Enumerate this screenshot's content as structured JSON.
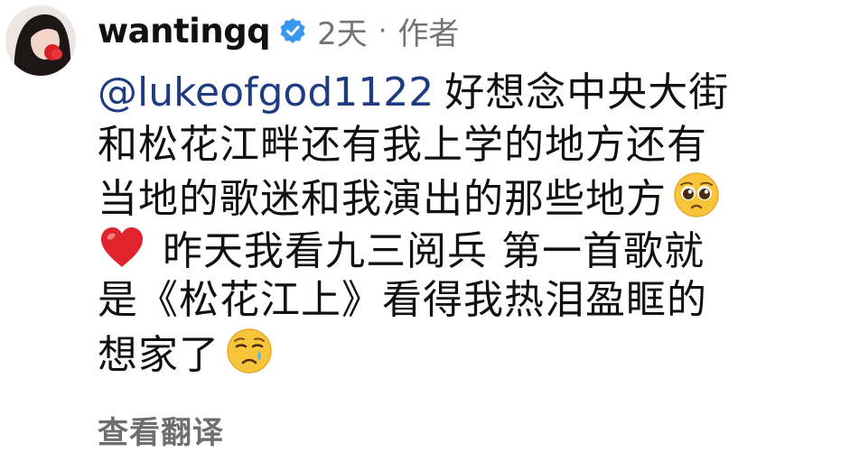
{
  "comment": {
    "username": "wantingq",
    "time": "2天",
    "separator": "·",
    "author_badge": "作者",
    "mention": "@lukeofgod1122",
    "lines": [
      "好想念中央大街",
      "和松花江畔还有我上学的地方还有",
      "当地的歌迷和我演出的那些地方",
      "昨天我看九三阅兵 第一首歌就",
      "是《松花江上》看得我热泪盈眶的",
      "想家了"
    ],
    "emojis": [
      "pleading-face-emoji",
      "red-heart-emoji",
      "crying-face-emoji"
    ],
    "see_translation": "查看翻译"
  },
  "colors": {
    "mention": "#1f3c82",
    "text": "#111111",
    "meta": "#737373",
    "verified": "#3897f0",
    "heart": "#e0242b",
    "emoji_yellow": "#f8c43a"
  }
}
